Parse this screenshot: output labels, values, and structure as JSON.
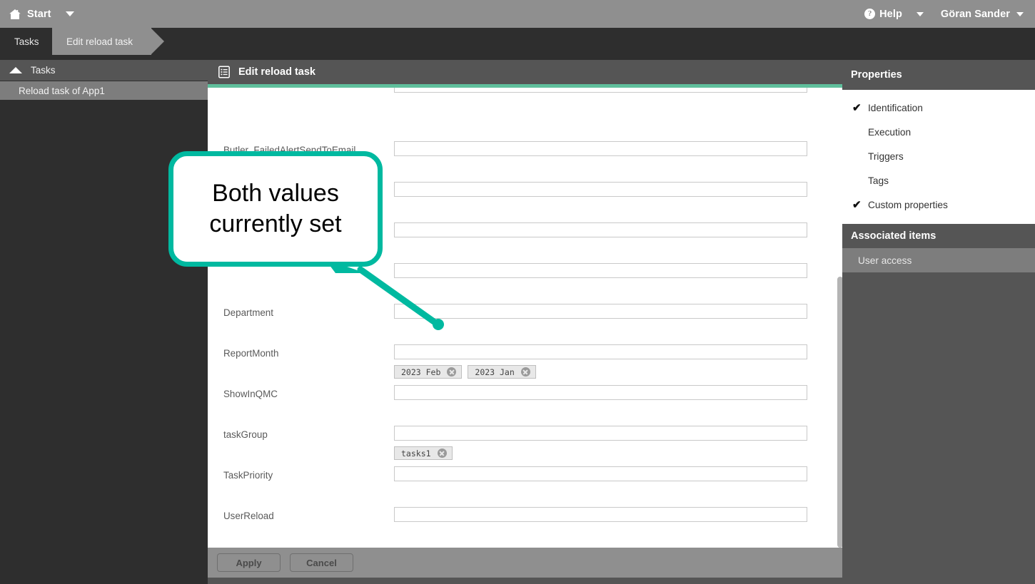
{
  "topbar": {
    "home_icon": "home-icon",
    "start_label": "Start",
    "start_caret": "chevron-down-icon",
    "help_icon": "question-mark-icon",
    "help_label": "Help",
    "help_caret": "chevron-down-icon",
    "user_label": "Göran Sander",
    "user_caret": "chevron-down-icon"
  },
  "breadcrumb": {
    "items": [
      {
        "label": "Tasks",
        "active": false
      },
      {
        "label": "Edit reload task",
        "active": true
      }
    ]
  },
  "leftnav": {
    "header": {
      "label": "Tasks",
      "icon": "chevron-up-icon"
    },
    "items": [
      {
        "label": "Reload task of App1",
        "selected": true
      }
    ]
  },
  "center": {
    "header": {
      "icon": "task-document-icon",
      "title": "Edit reload task"
    },
    "accent_color": "#5fbf9c",
    "fields": [
      {
        "label": "Butler_FailedAlertSendToEmail",
        "value": "",
        "chips": []
      },
      {
        "label": "",
        "value": "",
        "chips": []
      },
      {
        "label": "",
        "value": "",
        "chips": []
      },
      {
        "label": "",
        "value": "",
        "chips": []
      },
      {
        "label": "Department",
        "value": "",
        "chips": []
      },
      {
        "label": "ReportMonth",
        "value": "",
        "chips": [
          "2023 Feb",
          "2023 Jan"
        ]
      },
      {
        "label": "ShowInQMC",
        "value": "",
        "chips": []
      },
      {
        "label": "taskGroup",
        "value": "",
        "chips": [
          "tasks1"
        ]
      },
      {
        "label": "TaskPriority",
        "value": "",
        "chips": []
      },
      {
        "label": "UserReload",
        "value": "",
        "chips": []
      }
    ],
    "footer": {
      "apply_label": "Apply",
      "cancel_label": "Cancel"
    }
  },
  "rightpanel": {
    "properties_title": "Properties",
    "properties": [
      {
        "label": "Identification",
        "checked": true
      },
      {
        "label": "Execution",
        "checked": false
      },
      {
        "label": "Triggers",
        "checked": false
      },
      {
        "label": "Tags",
        "checked": false
      },
      {
        "label": "Custom properties",
        "checked": true
      }
    ],
    "check_glyph": "✔",
    "associated_title": "Associated items",
    "associated": [
      {
        "label": "User access",
        "selected": true
      }
    ]
  },
  "callout": {
    "line1": "Both values",
    "line2": "currently set",
    "color": "#00b9a0"
  }
}
